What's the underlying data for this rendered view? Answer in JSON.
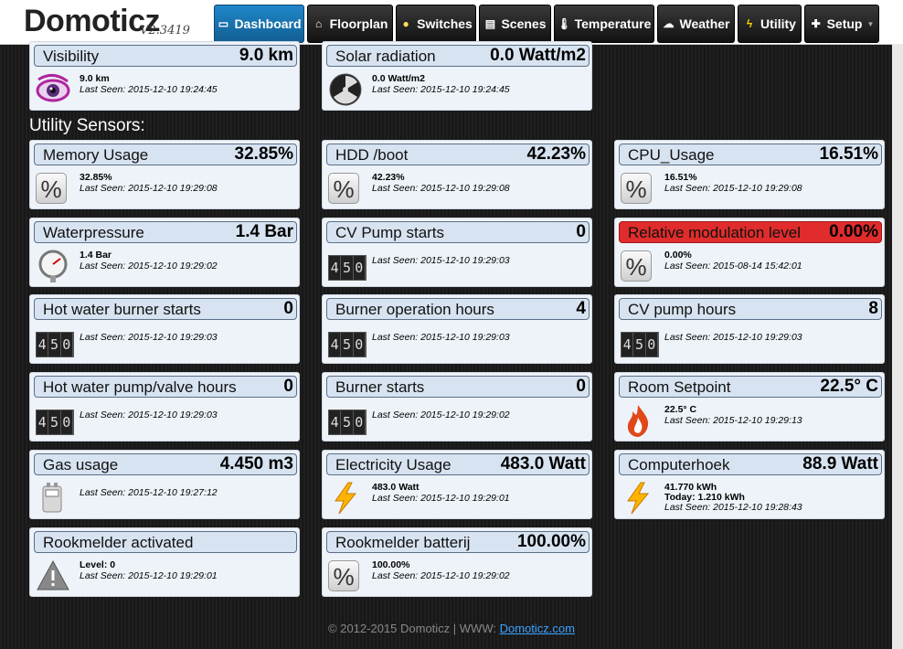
{
  "app": {
    "title": "Domoticz",
    "version": "V2.3419"
  },
  "nav": [
    {
      "label": "Dashboard",
      "icon": "dashboard-icon"
    },
    {
      "label": "Floorplan",
      "icon": "floorplan-icon"
    },
    {
      "label": "Switches",
      "icon": "lightbulb-icon"
    },
    {
      "label": "Scenes",
      "icon": "scenes-icon"
    },
    {
      "label": "Temperature",
      "icon": "thermometer-icon"
    },
    {
      "label": "Weather",
      "icon": "cloud-icon"
    },
    {
      "label": "Utility",
      "icon": "lightning-icon"
    },
    {
      "label": "Setup",
      "icon": "tools-icon"
    }
  ],
  "section": {
    "utility_title": "Utility Sensors:"
  },
  "weather_cards": [
    {
      "name": "Visibility",
      "value": "9.0 km",
      "line1": "9.0 km",
      "last_seen": "Last Seen: 2015-12-10 19:24:45",
      "icon": "eye-icon"
    },
    {
      "name": "Solar radiation",
      "value": "0.0 Watt/m2",
      "line1": "0.0 Watt/m2",
      "last_seen": "Last Seen: 2015-12-10 19:24:45",
      "icon": "radiation-icon"
    }
  ],
  "utility_cards": [
    {
      "name": "Memory Usage",
      "value": "32.85%",
      "line1": "32.85%",
      "last_seen": "Last Seen: 2015-12-10 19:29:08",
      "icon": "percent-icon"
    },
    {
      "name": "HDD /boot",
      "value": "42.23%",
      "line1": "42.23%",
      "last_seen": "Last Seen: 2015-12-10 19:29:08",
      "icon": "percent-icon"
    },
    {
      "name": "CPU_Usage",
      "value": "16.51%",
      "line1": "16.51%",
      "last_seen": "Last Seen: 2015-12-10 19:29:08",
      "icon": "percent-icon"
    },
    {
      "name": "Waterpressure",
      "value": "1.4 Bar",
      "line1": "1.4 Bar",
      "last_seen": "Last Seen: 2015-12-10 19:29:02",
      "icon": "gauge-icon"
    },
    {
      "name": "CV Pump starts",
      "value": "0",
      "line1": "",
      "last_seen": "Last Seen: 2015-12-10 19:29:03",
      "icon": "counter-icon"
    },
    {
      "name": "Relative modulation level",
      "value": "0.00%",
      "line1": "0.00%",
      "last_seen": "Last Seen: 2015-08-14 15:42:01",
      "icon": "percent-icon",
      "alert": true
    },
    {
      "name": "Hot water burner starts",
      "value": "0",
      "line1": "",
      "last_seen": "Last Seen: 2015-12-10 19:29:03",
      "icon": "counter-icon"
    },
    {
      "name": "Burner operation hours",
      "value": "4",
      "line1": "",
      "last_seen": "Last Seen: 2015-12-10 19:29:03",
      "icon": "counter-icon"
    },
    {
      "name": "CV pump hours",
      "value": "8",
      "line1": "",
      "last_seen": "Last Seen: 2015-12-10 19:29:03",
      "icon": "counter-icon"
    },
    {
      "name": "Hot water pump/valve hours",
      "value": "0",
      "line1": "",
      "last_seen": "Last Seen: 2015-12-10 19:29:03",
      "icon": "counter-icon"
    },
    {
      "name": "Burner starts",
      "value": "0",
      "line1": "",
      "last_seen": "Last Seen: 2015-12-10 19:29:02",
      "icon": "counter-icon"
    },
    {
      "name": "Room Setpoint",
      "value": "22.5° C",
      "line1": "22.5° C",
      "last_seen": "Last Seen: 2015-12-10 19:29:13",
      "icon": "flame-icon"
    },
    {
      "name": "Gas usage",
      "value": "4.450 m3",
      "line1": "",
      "last_seen": "Last Seen: 2015-12-10 19:27:12",
      "icon": "gas-meter-icon"
    },
    {
      "name": "Electricity Usage",
      "value": "483.0 Watt",
      "line1": "483.0 Watt",
      "last_seen": "Last Seen: 2015-12-10 19:29:01",
      "icon": "lightning-icon"
    },
    {
      "name": "Computerhoek",
      "value": "88.9 Watt",
      "line1": "41.770 kWh",
      "line1b": "Today: 1.210 kWh",
      "last_seen": "Last Seen: 2015-12-10 19:28:43",
      "icon": "lightning-icon"
    },
    {
      "name": "Rookmelder activated",
      "value": "",
      "line1": "Level: 0",
      "last_seen": "Last Seen: 2015-12-10 19:29:01",
      "icon": "warning-icon"
    },
    {
      "name": "Rookmelder batterij",
      "value": "100.00%",
      "line1": "100.00%",
      "last_seen": "Last Seen: 2015-12-10 19:29:02",
      "icon": "percent-icon"
    }
  ],
  "counter_digits": "450",
  "footer": {
    "copyright": "© 2012-2015 Domoticz | WWW: ",
    "link": "Domoticz.com"
  },
  "colors": {
    "accent": "#1f86c9",
    "alert": "#e02c2c"
  }
}
